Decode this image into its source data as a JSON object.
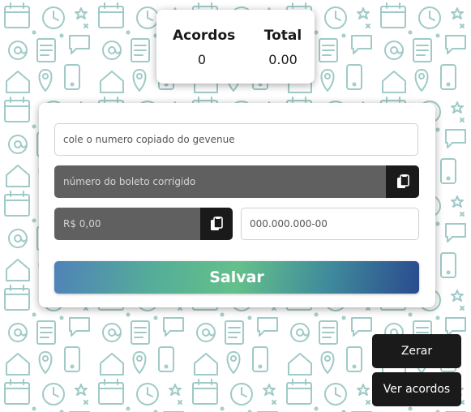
{
  "summary": {
    "acordos_label": "Acordos",
    "acordos_value": "0",
    "total_label": "Total",
    "total_value": "0.00"
  },
  "form": {
    "gevenue_placeholder": "cole o numero copiado do gevenue",
    "boleto_placeholder": "número do boleto corrigido",
    "valor_placeholder": "R$ 0,00",
    "documento_placeholder": "000.000.000-00",
    "save_label": "Salvar"
  },
  "actions": {
    "zerar_label": "Zerar",
    "ver_acordos_label": "Ver acordos"
  },
  "icons": {
    "copy": "clipboard-paste-icon"
  },
  "colors": {
    "pattern": "#9fcac7",
    "dark_field": "#606060",
    "button_dark": "#1a1a1a"
  }
}
